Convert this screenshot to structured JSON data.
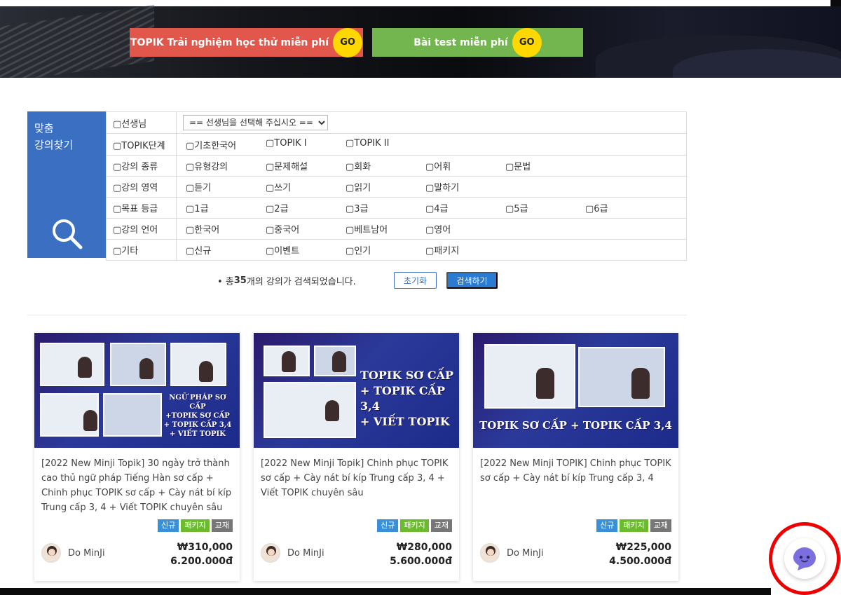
{
  "banner": {
    "cta_trial": "TOPIK Trải nghiệm học thử miễn phí",
    "cta_test": "Bài test miễn phí",
    "go": "GO"
  },
  "finder": {
    "title_line1": "맞춤",
    "title_line2": "강의찾기"
  },
  "filters": {
    "teacher_label": "선생님",
    "teacher_select": "== 선생님을 선택해 주십시오 ==",
    "rows": [
      {
        "label": "TOPIK단계",
        "options": [
          "기초한국어",
          "TOPIK I",
          "TOPIK II"
        ]
      },
      {
        "label": "강의 종류",
        "options": [
          "유형강의",
          "문제해설",
          "회화",
          "어휘",
          "문법"
        ]
      },
      {
        "label": "강의 영역",
        "options": [
          "듣기",
          "쓰기",
          "읽기",
          "말하기"
        ]
      },
      {
        "label": "목표 등급",
        "options": [
          "1급",
          "2급",
          "3급",
          "4급",
          "5급",
          "6급"
        ]
      },
      {
        "label": "강의 언어",
        "options": [
          "한국어",
          "중국어",
          "베트남어",
          "영어"
        ]
      },
      {
        "label": "기타",
        "options": [
          "신규",
          "이벤트",
          "인기",
          "패키지"
        ]
      }
    ]
  },
  "result": {
    "prefix": "• 총 ",
    "count": "35",
    "suffix": "개의 강의가 검색되었습니다."
  },
  "buttons": {
    "reset": "초기화",
    "search": "검색하기"
  },
  "courses": [
    {
      "thumb_title": [
        "NGỮ PHÁP SƠ CẤP",
        "+TOPIK SƠ CẤP",
        "+ TOPIK CẤP 3,4",
        "+ VIẾT TOPIK"
      ],
      "description": "[2022 New Minji Topik] 30 ngày trở thành cao thủ ngữ pháp Tiếng Hàn sơ cấp + Chinh phục TOPIK sơ cấp + Cày nát bí kíp Trung cấp 3, 4 + Viết TOPIK chuyên sâu",
      "tags": [
        "신규",
        "패키지",
        "교재"
      ],
      "author": "Do MinJi",
      "price_krw": "₩310,000",
      "price_vnd": "6.200.000đ"
    },
    {
      "thumb_title": [
        "TOPIK SƠ CẤP",
        "+ TOPIK CẤP 3,4",
        "+ VIẾT TOPIK"
      ],
      "description": "[2022 New Minji Topik] Chinh phục TOPIK sơ cấp + Cày nát bí kíp Trung cấp 3, 4 + Viết TOPIK chuyên sâu",
      "tags": [
        "신규",
        "패키지",
        "교재"
      ],
      "author": "Do MinJi",
      "price_krw": "₩280,000",
      "price_vnd": "5.600.000đ"
    },
    {
      "thumb_title": [
        "TOPIK SƠ CẤP + TOPIK CẤP 3,4"
      ],
      "description": "[2022 New Minji TOPIK] Chinh phục TOPIK sơ cấp + Cày nát bí kíp Trung cấp 3, 4",
      "tags": [
        "신규",
        "패키지",
        "교재"
      ],
      "author": "Do MinJi",
      "price_krw": "₩225,000",
      "price_vnd": "4.500.000đ"
    }
  ],
  "colors": {
    "blue": "#3a6fc2",
    "red_cta": "#e2574c",
    "green_cta": "#73b650",
    "go": "#ffd800"
  },
  "icons": {
    "finder": "search-icon",
    "chat": "chat-bot-icon"
  }
}
